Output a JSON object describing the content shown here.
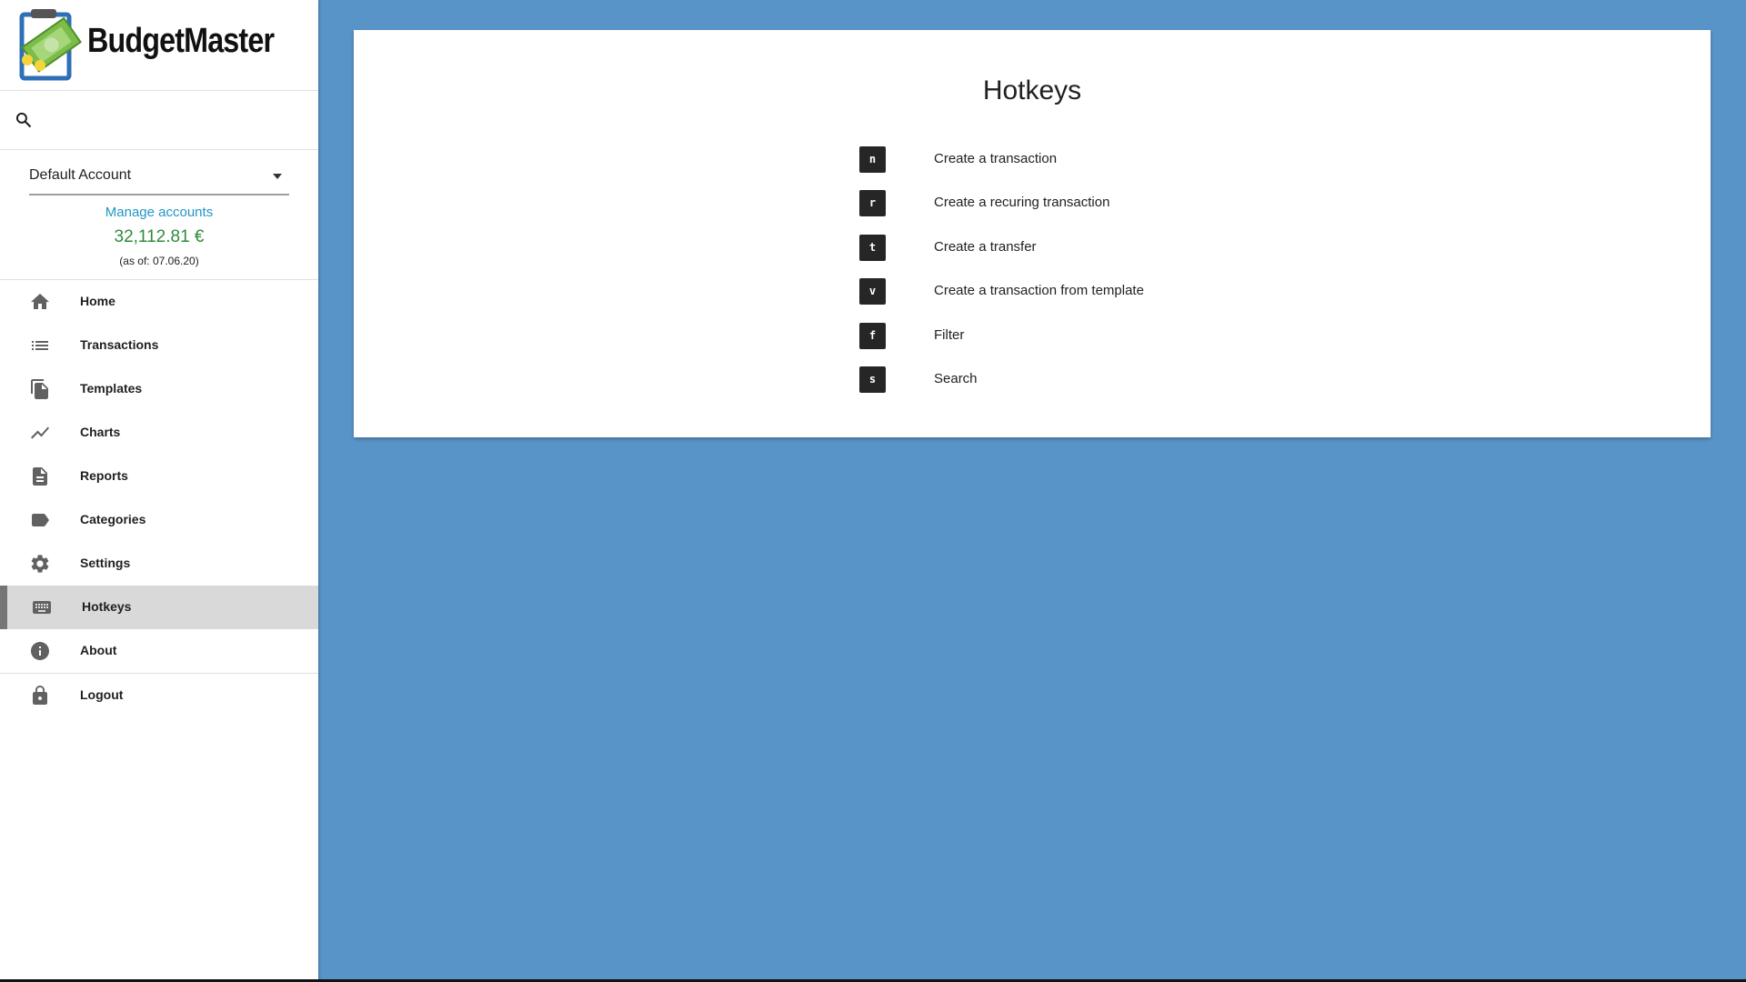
{
  "app": {
    "name": "BudgetMaster"
  },
  "search": {
    "placeholder": ""
  },
  "account": {
    "selected": "Default Account",
    "manage_link": "Manage accounts",
    "balance": "32,112.81 €",
    "as_of": "(as of: 07.06.20)"
  },
  "nav": {
    "items": [
      {
        "label": "Home",
        "icon": "home-icon"
      },
      {
        "label": "Transactions",
        "icon": "list-icon"
      },
      {
        "label": "Templates",
        "icon": "file-copy-icon"
      },
      {
        "label": "Charts",
        "icon": "chart-line-icon"
      },
      {
        "label": "Reports",
        "icon": "description-icon"
      },
      {
        "label": "Categories",
        "icon": "label-icon"
      },
      {
        "label": "Settings",
        "icon": "gear-icon"
      },
      {
        "label": "Hotkeys",
        "icon": "keyboard-icon",
        "active": true
      },
      {
        "label": "About",
        "icon": "info-icon"
      },
      {
        "label": "Logout",
        "icon": "lock-icon"
      }
    ]
  },
  "main": {
    "title": "Hotkeys",
    "hotkeys": [
      {
        "key": "n",
        "description": "Create a transaction"
      },
      {
        "key": "r",
        "description": "Create a recuring transaction"
      },
      {
        "key": "t",
        "description": "Create a transfer"
      },
      {
        "key": "v",
        "description": "Create a transaction from template"
      },
      {
        "key": "f",
        "description": "Filter"
      },
      {
        "key": "s",
        "description": "Search"
      }
    ]
  },
  "colors": {
    "background": "#5994c9",
    "balance": "#2e8b3c",
    "link": "#2196c4",
    "key": "#262626"
  }
}
